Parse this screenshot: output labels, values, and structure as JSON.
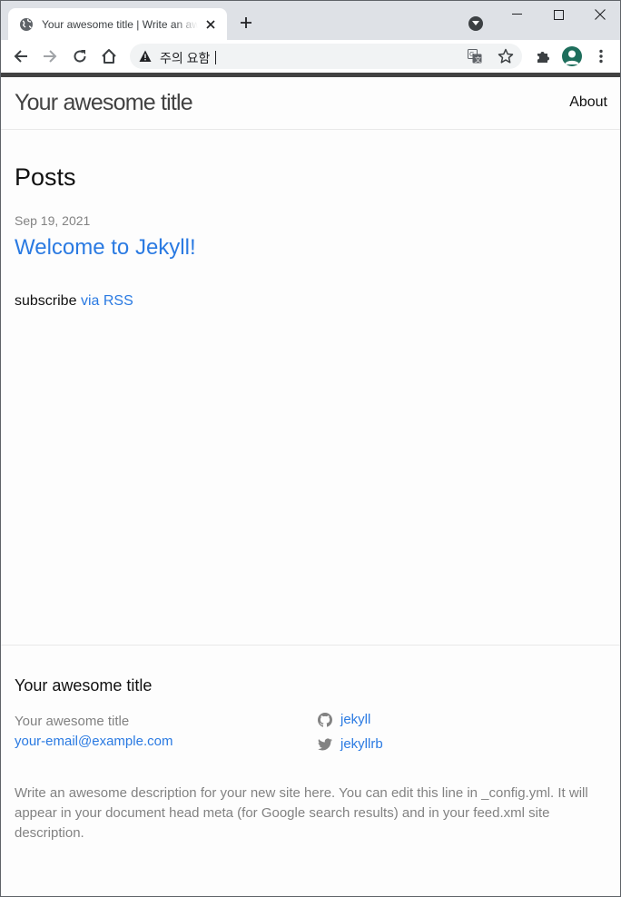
{
  "browser": {
    "tab_title": "Your awesome title | Write an awesome description",
    "address_text": "주의 요함",
    "accent": "#1e6e5c"
  },
  "icons": {
    "favicon": "globe-icon",
    "tab_close": "close-icon",
    "new_tab": "plus-icon",
    "tab_search": "chevron-down-icon",
    "back": "arrow-left-icon",
    "forward": "arrow-right-icon",
    "reload": "reload-icon",
    "home": "home-icon",
    "warning": "warning-icon",
    "translate": "translate-icon",
    "bookmark": "star-icon",
    "extensions": "puzzle-icon",
    "profile": "avatar-icon",
    "menu": "kebab-menu-icon"
  },
  "header": {
    "site_title": "Your awesome title",
    "nav_about": "About"
  },
  "main": {
    "heading": "Posts",
    "posts": [
      {
        "date": "Sep 19, 2021",
        "title": "Welcome to Jekyll!"
      }
    ],
    "rss_prefix": "subscribe",
    "rss_link": "via RSS"
  },
  "footer": {
    "heading": "Your awesome title",
    "name": "Your awesome title",
    "email": "your-email@example.com",
    "social": [
      {
        "icon": "github-icon",
        "label": "jekyll"
      },
      {
        "icon": "twitter-icon",
        "label": "jekyllrb"
      }
    ],
    "description": "Write an awesome description for your new site here. You can edit this line in _config.yml. It will appear in your document head meta (for Google search results) and in your feed.xml site description."
  },
  "colors": {
    "link": "#2a7ae2",
    "meta": "#828282",
    "text": "#111111"
  }
}
